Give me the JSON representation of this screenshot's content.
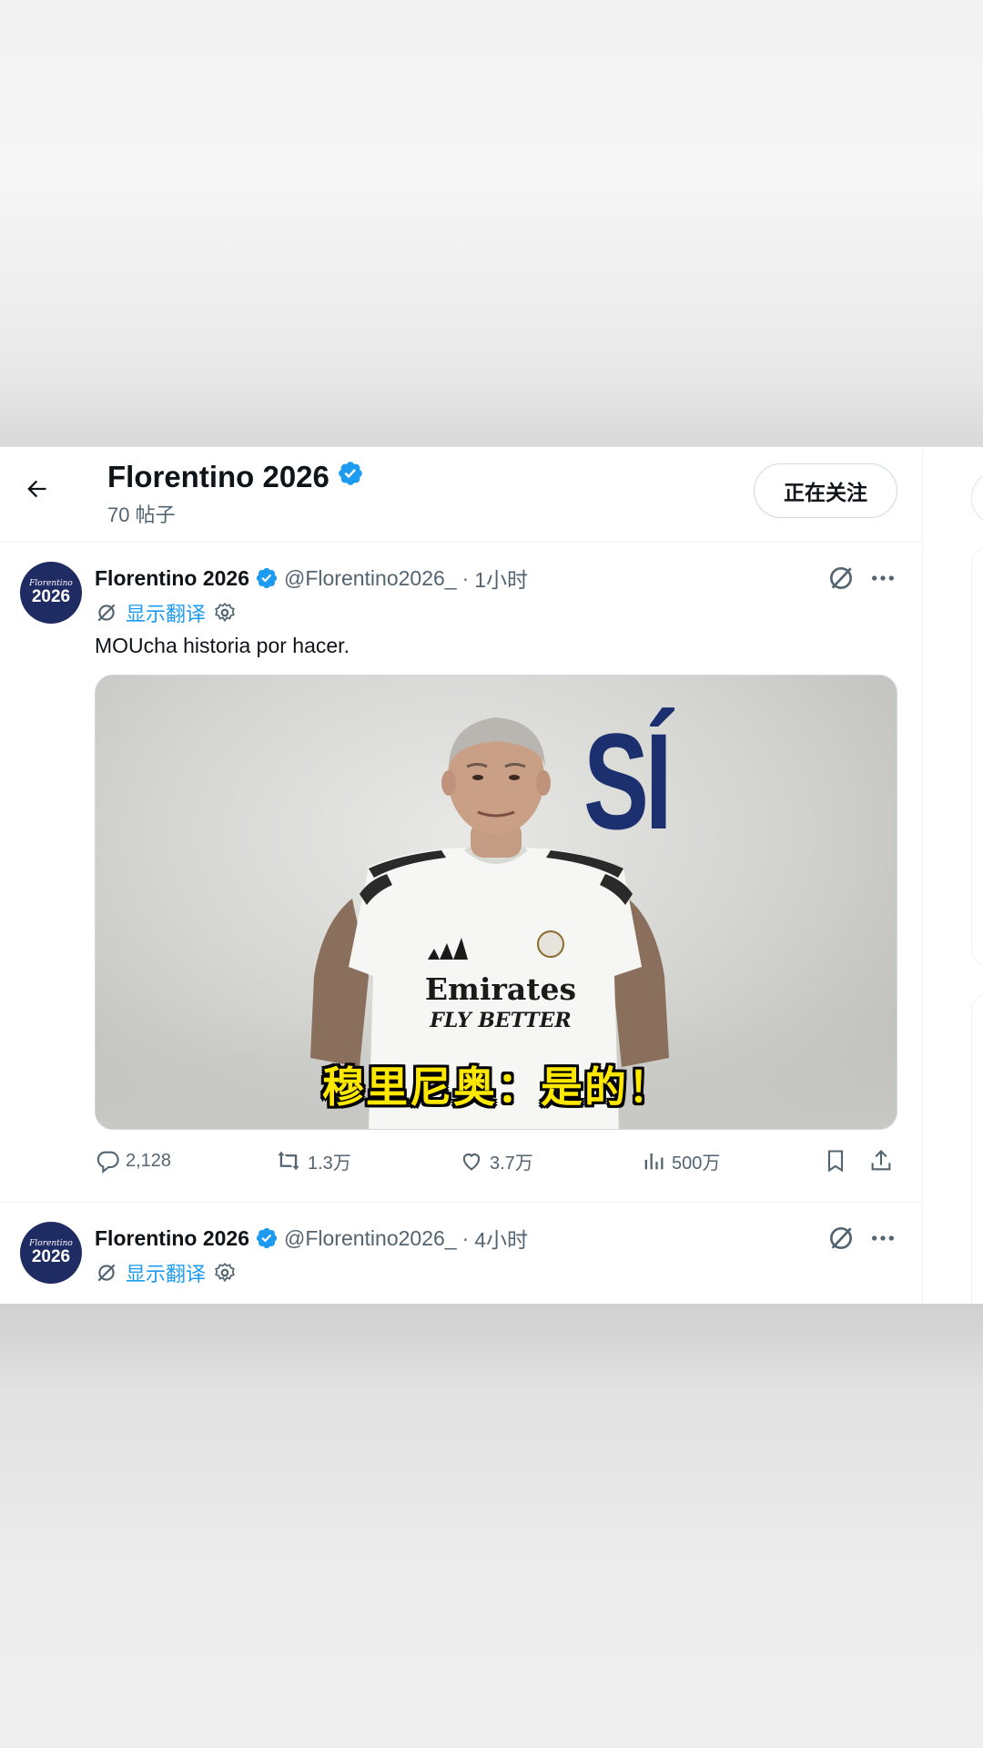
{
  "header": {
    "title": "Florentino 2026",
    "post_count": "70 帖子",
    "follow_label": "正在关注"
  },
  "tweets": [
    {
      "avatar_top": "Florentino",
      "avatar_year": "2026",
      "name": "Florentino 2026",
      "handle": "@Florentino2026_",
      "separator": "·",
      "time": "1小时",
      "translate_label": "显示翻译",
      "text": "MOUcha historia por hacer.",
      "media": {
        "backdrop_text": "SÍ",
        "jersey_sponsor": "Emirates",
        "jersey_tagline": "FLY BETTER",
        "subtitle": "穆里尼奥：是的！"
      },
      "actions": {
        "replies": "2,128",
        "retweets": "1.3万",
        "likes": "3.7万",
        "views": "500万"
      }
    },
    {
      "avatar_top": "Florentino",
      "avatar_year": "2026",
      "name": "Florentino 2026",
      "handle": "@Florentino2026_",
      "separator": "·",
      "time": "4小时",
      "translate_label": "显示翻译"
    }
  ],
  "colors": {
    "verified": "#1d9bf0",
    "link": "#1d9bf0",
    "secondary_text": "#536471",
    "backdrop_text": "#1c2f6e",
    "subtitle": "#ffe800"
  },
  "icons": [
    "back-arrow-icon",
    "verified-badge-icon",
    "grok-icon",
    "more-icon",
    "translate-icon",
    "settings-icon",
    "reply-icon",
    "retweet-icon",
    "like-icon",
    "views-icon",
    "bookmark-icon",
    "share-icon"
  ]
}
